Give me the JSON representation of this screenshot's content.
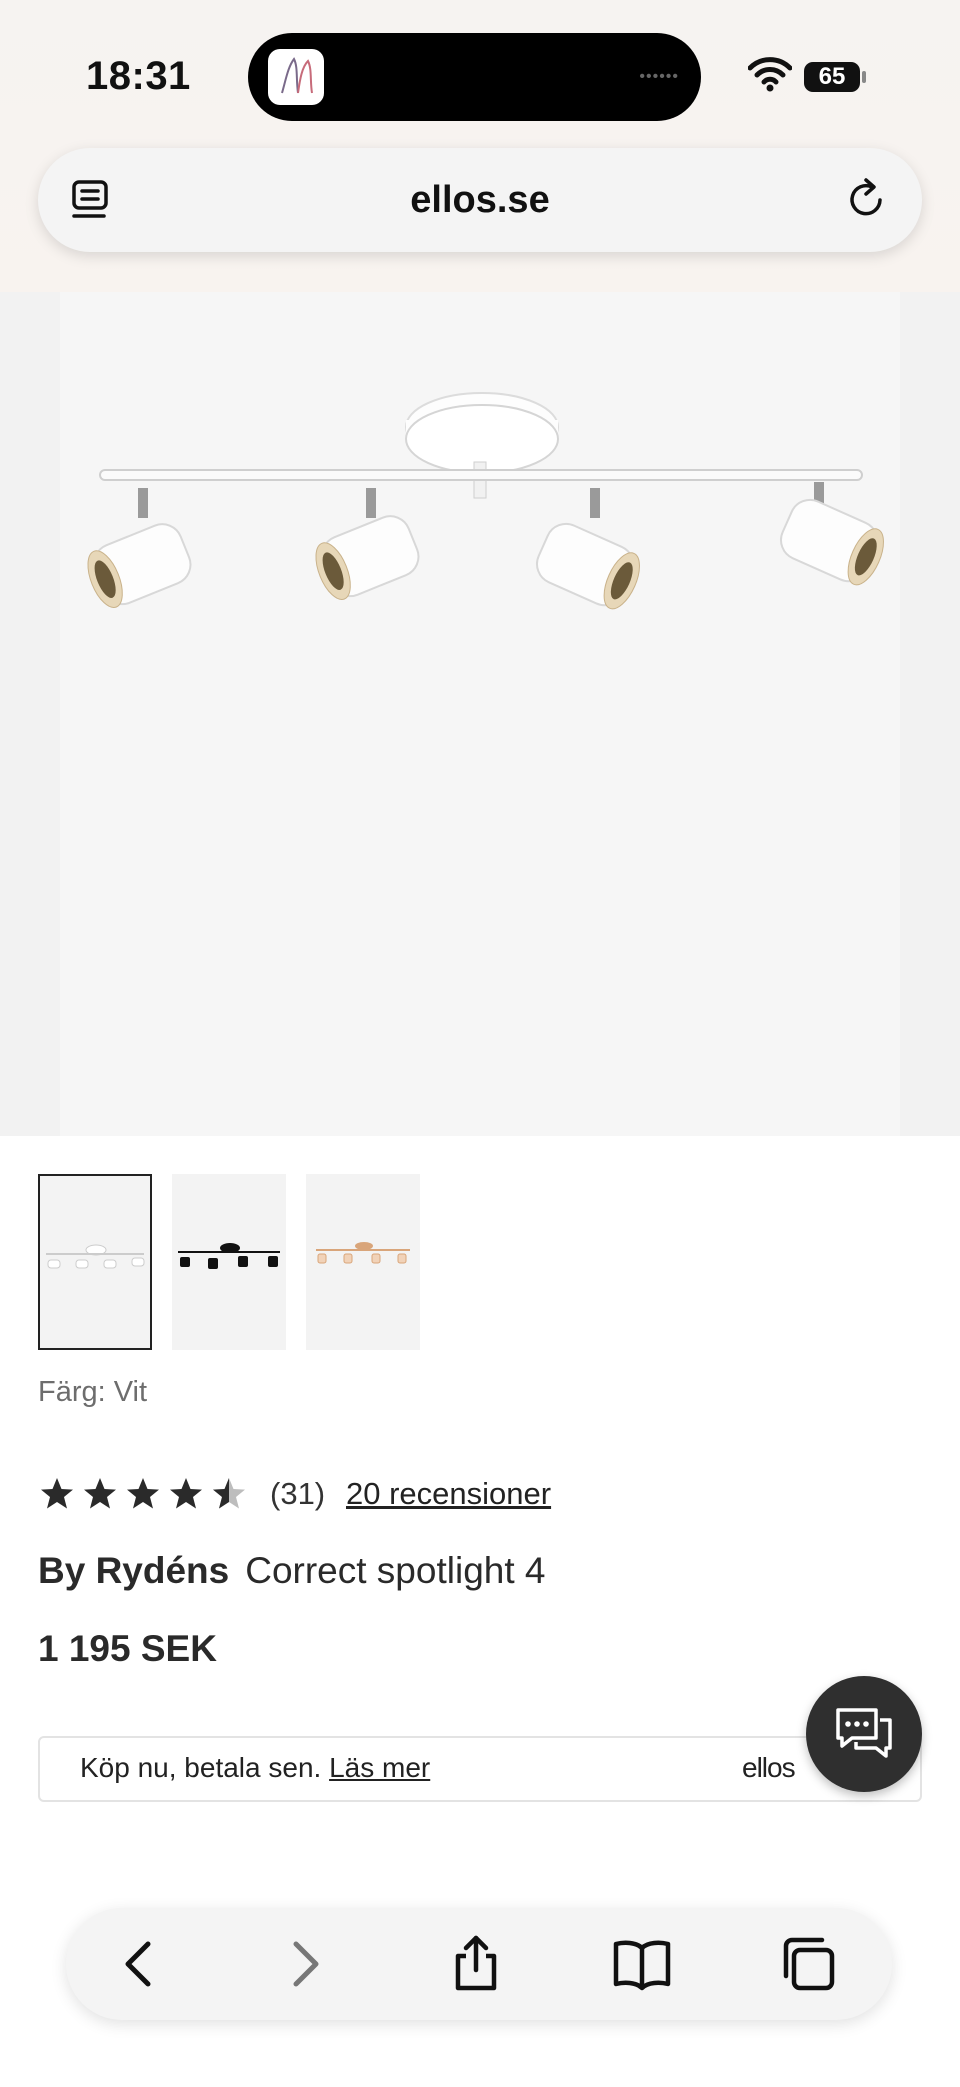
{
  "status_bar": {
    "time": "18:31",
    "battery": "65",
    "icons": [
      "wifi-icon",
      "battery-icon"
    ]
  },
  "browser": {
    "url": "ellos.se",
    "icons": [
      "reader-icon",
      "reload-icon"
    ]
  },
  "product": {
    "color_label": "Färg: Vit",
    "thumbnails": [
      "white",
      "black",
      "copper"
    ],
    "rating": {
      "value": 4.5,
      "max": 5,
      "count": "(31)",
      "reviews_link": "20 recensioner"
    },
    "brand": "By Rydéns",
    "name": "Correct spotlight 4",
    "price": "1 195 SEK"
  },
  "paylater": {
    "text": "Köp nu, betala sen.",
    "link": "Läs mer",
    "logo": "ellos"
  },
  "toolbar": {
    "icons": [
      "back-icon",
      "forward-icon",
      "share-icon",
      "bookmarks-icon",
      "tabs-icon"
    ]
  },
  "colors": {
    "selected_border": "#222222",
    "chat_button": "#2f2f2f",
    "background": "#ffffff"
  }
}
